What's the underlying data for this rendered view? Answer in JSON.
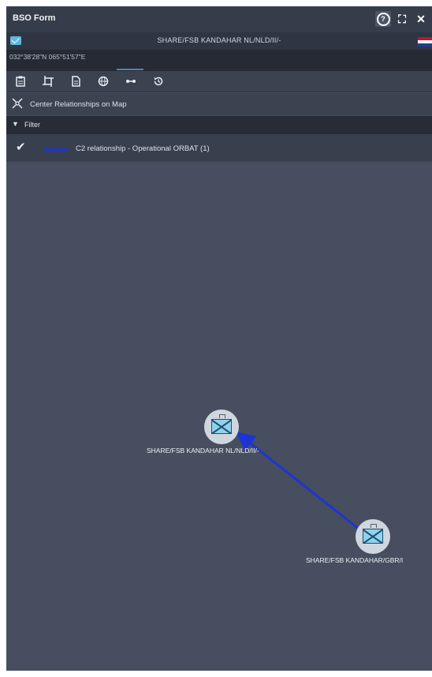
{
  "window": {
    "title": "BSO Form"
  },
  "unit": {
    "name": "SHARE/FSB KANDAHAR NL/NLD/II/-"
  },
  "coords": "032°38'28\"N 065°51'57\"E",
  "toolbar": {
    "icons": [
      "clipboard-icon",
      "crop-icon",
      "document-icon",
      "globe-icon",
      "link-icon",
      "history-icon"
    ]
  },
  "center": {
    "label": "Center Relationships on Map"
  },
  "filter": {
    "header": "Filter",
    "items": [
      {
        "label": "C2 relationship - Operational ORBAT (1)",
        "color": "#1c34d6"
      }
    ]
  },
  "graph": {
    "nodes": [
      {
        "label": "SHARE/FSB KANDAHAR NL/NLD/II/-"
      },
      {
        "label": "SHARE/FSB KANDAHAR/GBR/I"
      }
    ],
    "edge_color": "#1c34d6"
  },
  "colors": {
    "background": "#464e5f",
    "titlebar": "#363d4a",
    "accent": "#5fb8de"
  }
}
